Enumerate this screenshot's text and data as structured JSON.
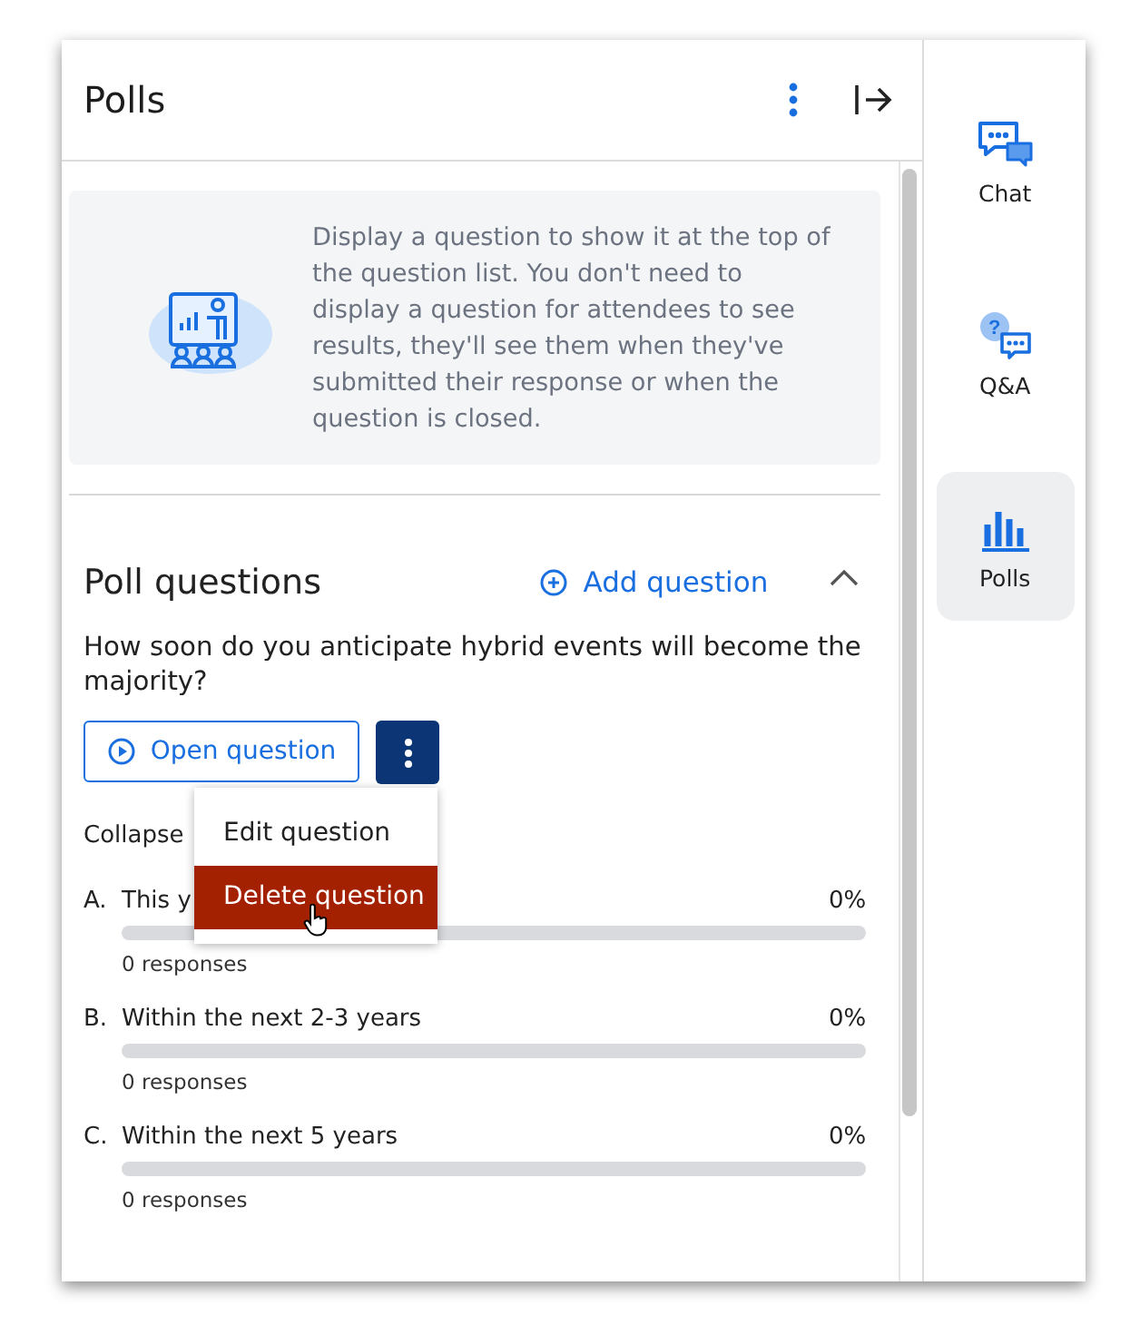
{
  "header": {
    "title": "Polls"
  },
  "info": {
    "text": "Display a question to show it at the top of the question list. You don't need to display a question for attendees to see results, they'll see them when they've submitted their response or when the question is closed."
  },
  "section": {
    "title": "Poll questions",
    "add_label": "Add question",
    "expanded": true
  },
  "question": {
    "text": "How soon do you anticipate hybrid events will become the majority?",
    "open_label": "Open question",
    "collapse_label": "Collapse"
  },
  "menu": [
    {
      "label": "Edit question",
      "highlighted": false
    },
    {
      "label": "Delete question",
      "highlighted": true
    }
  ],
  "options": [
    {
      "letter": "A.",
      "label": "This y",
      "percent": "0%",
      "level": 0,
      "responses": "0 responses"
    },
    {
      "letter": "B.",
      "label": "Within the next 2-3 years",
      "percent": "0%",
      "level": 0,
      "responses": "0 responses"
    },
    {
      "letter": "C.",
      "label": "Within the next 5 years",
      "percent": "0%",
      "level": 0,
      "responses": "0 responses"
    }
  ],
  "sidebar": [
    {
      "kind": "chat",
      "label": "Chat",
      "selected": false
    },
    {
      "kind": "qa",
      "label": "Q&A",
      "glyph": "?",
      "selected": false
    },
    {
      "kind": "polls",
      "label": "Polls",
      "selected": true
    }
  ]
}
